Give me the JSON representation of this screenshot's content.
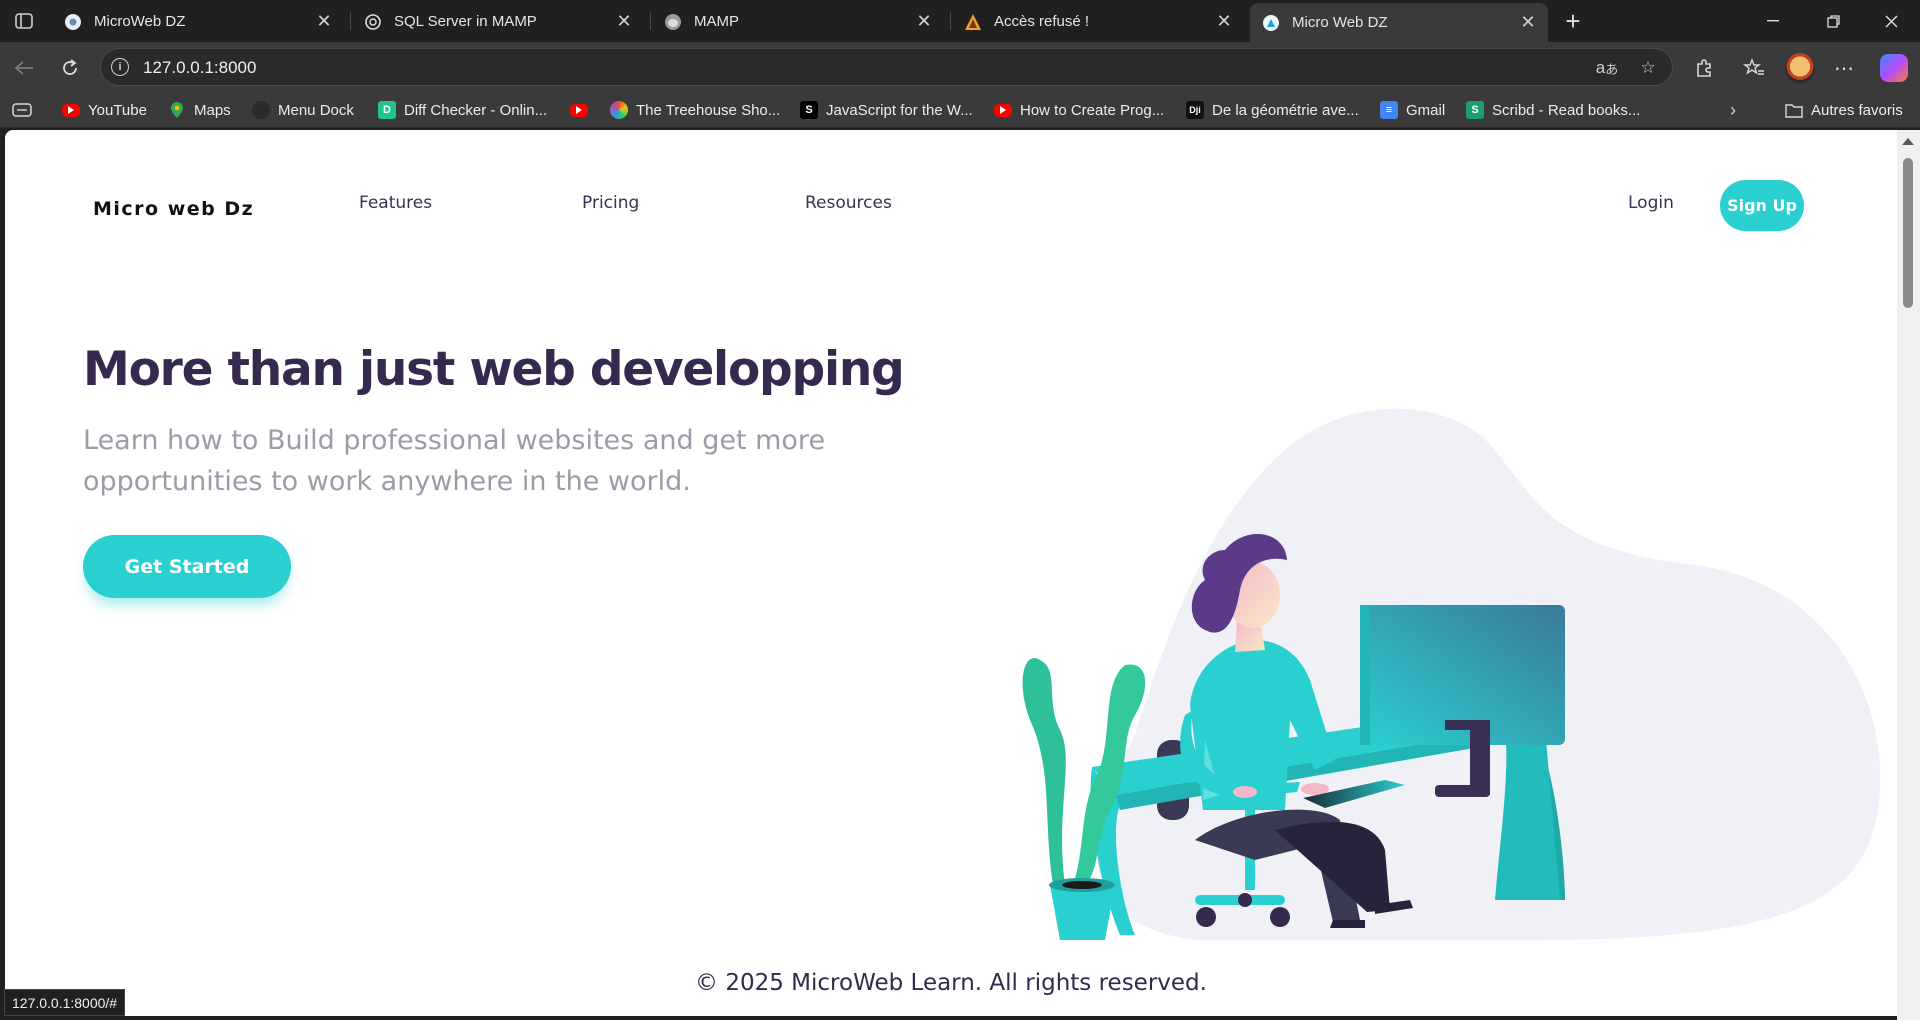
{
  "browser": {
    "tabs": [
      {
        "title": "MicroWeb DZ",
        "icon": "microweb-favicon"
      },
      {
        "title": "SQL Server in MAMP",
        "icon": "chatgpt-favicon"
      },
      {
        "title": "MAMP",
        "icon": "mamp-elephant-favicon"
      },
      {
        "title": "Accès refusé !",
        "icon": "warning-favicon"
      },
      {
        "title": "Micro Web DZ",
        "icon": "microweb-favicon",
        "active": true
      }
    ],
    "address": {
      "url": "127.0.0.1:8000"
    },
    "bookmarks": [
      {
        "label": "YouTube",
        "icon": "youtube-icon"
      },
      {
        "label": "Maps",
        "icon": "maps-icon"
      },
      {
        "label": "Menu Dock",
        "icon": "github-icon"
      },
      {
        "label": "Diff Checker - Onlin...",
        "icon": "diffchecker-icon"
      },
      {
        "label": "",
        "icon": "youtube-icon"
      },
      {
        "label": "The Treehouse Sho...",
        "icon": "treehouse-icon"
      },
      {
        "label": "JavaScript for the W...",
        "icon": "scrimba-icon"
      },
      {
        "label": "How to Create Prog...",
        "icon": "youtube-icon"
      },
      {
        "label": "De la géométrie ave...",
        "icon": "dji-icon"
      },
      {
        "label": "Gmail",
        "icon": "docs-icon"
      },
      {
        "label": "Scribd - Read books...",
        "icon": "scribd-icon"
      }
    ],
    "other_favorites": "Autres favoris",
    "status_url": "127.0.0.1:8000/#"
  },
  "site": {
    "logo": "Micro web Dz",
    "nav": {
      "features": "Features",
      "pricing": "Pricing",
      "resources": "Resources"
    },
    "login": "Login",
    "signup": "Sign Up",
    "hero": {
      "title": "More than just web developping",
      "subtitle": "Learn how to Build professional websites and get more opportunities to work anywhere in the world.",
      "cta": "Get Started"
    },
    "footer": "© 2025 MicroWeb Learn. All rights reserved."
  },
  "colors": {
    "accent": "#2acfcf",
    "heading": "#35294f",
    "muted": "#9e9aa7",
    "blob": "#f0f1f6"
  }
}
